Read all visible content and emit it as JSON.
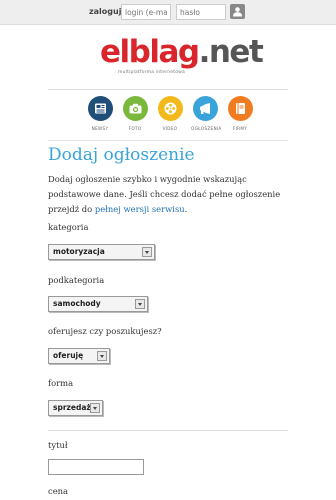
{
  "topbar": {
    "login_label": "zaloguj",
    "email_placeholder": "login (e-mail)",
    "password_placeholder": "hasło",
    "login_icon": "user-icon"
  },
  "logo": {
    "word_red": "elblag",
    "word_grey": ".net",
    "tagline": "multiplatforma internetowa"
  },
  "categories": [
    {
      "label": "NEWSY",
      "icon": "newspaper-icon",
      "color": "#1f4e79"
    },
    {
      "label": "FOTO",
      "icon": "camera-icon",
      "color": "#7ab83c"
    },
    {
      "label": "VIDEO",
      "icon": "film-reel-icon",
      "color": "#f2b91c"
    },
    {
      "label": "OGŁOSZENIA",
      "icon": "megaphone-icon",
      "color": "#3aa3da"
    },
    {
      "label": "FIRMY",
      "icon": "book-icon",
      "color": "#f07c22"
    }
  ],
  "page": {
    "title": "Dodaj ogłoszenie",
    "intro_text": "Dodaj ogłoszenie szybko i wygodnie wskazując podstawowe dane. Jeśli chcesz dodać pełne ogłoszenie przejdź do ",
    "intro_link": "pełnej wersji serwisu",
    "intro_end": "."
  },
  "form": {
    "kategoria_label": "kategoria",
    "kategoria_value": "motoryzacja",
    "podkategoria_label": "podkategoria",
    "podkategoria_value": "samochody",
    "oferujesz_label": "oferujesz czy poszukujesz?",
    "oferujesz_value": "oferuję",
    "forma_label": "forma",
    "forma_value": "sprzedaż",
    "tytul_label": "tytuł",
    "tytul_value": "",
    "cena_label": "cena"
  },
  "colors": {
    "accent": "#3aa3da",
    "brand_red": "#d8262c",
    "link": "#1f6fb4"
  }
}
